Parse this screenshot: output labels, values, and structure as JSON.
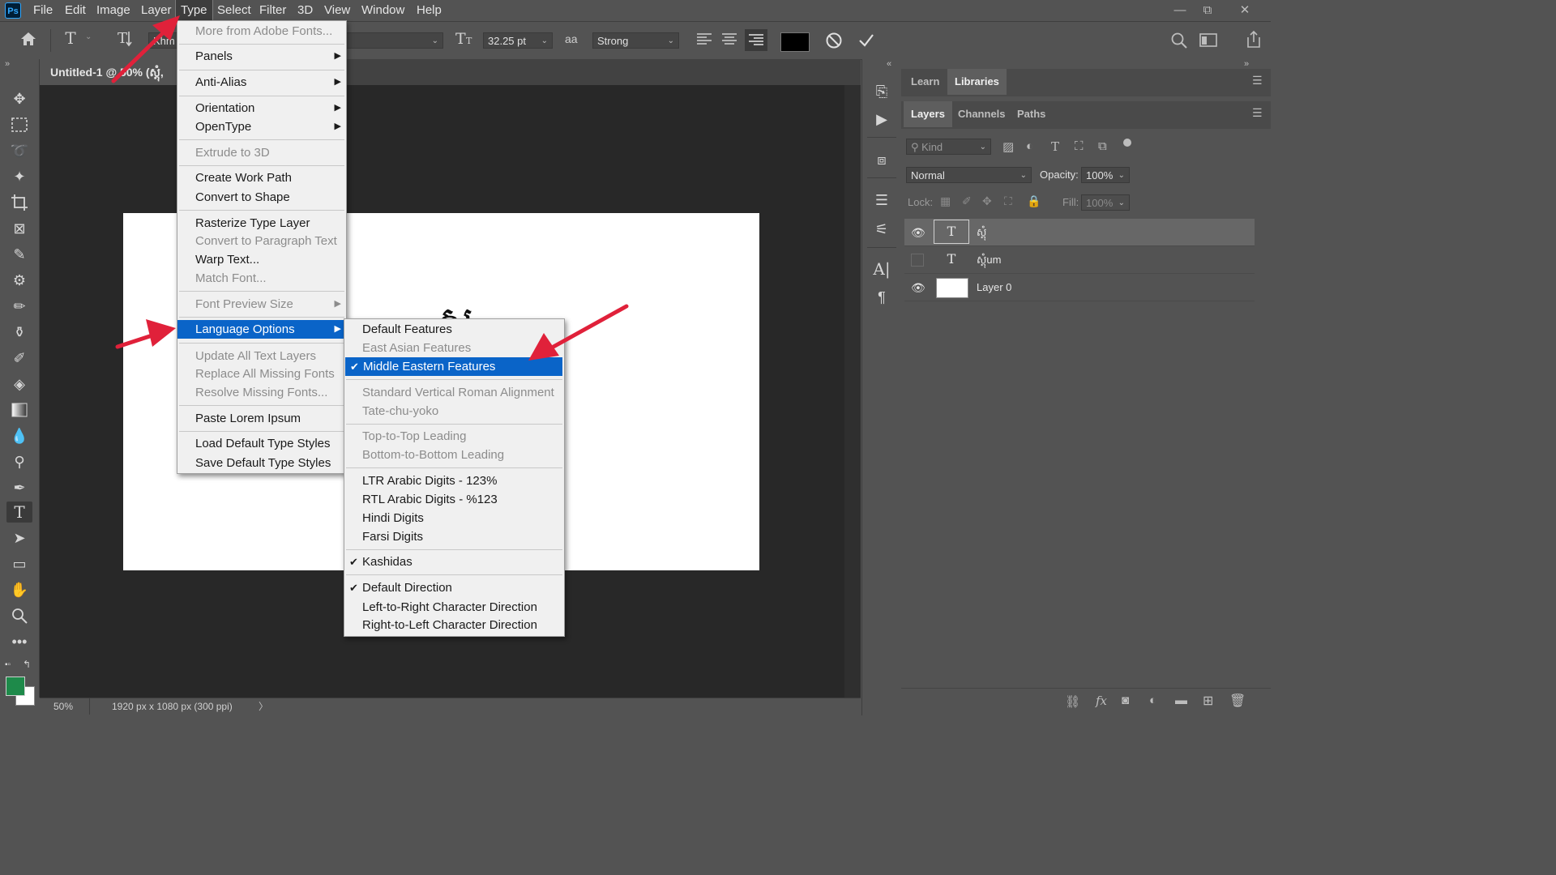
{
  "menubar": {
    "logo": "Ps",
    "items": [
      "File",
      "Edit",
      "Image",
      "Layer",
      "Type",
      "Select",
      "Filter",
      "3D",
      "View",
      "Window",
      "Help"
    ],
    "active": "Type",
    "window_controls": [
      "—",
      "⧉",
      "✕"
    ]
  },
  "options": {
    "font_family": "Khm",
    "font_size": "32.25 pt",
    "anti_alias_icon": "aa",
    "anti_alias": "Strong",
    "color": "#000000"
  },
  "document": {
    "tab_title": "Untitled-1 @ 50% (ស្តុំ,",
    "zoom": "50%",
    "doc_info": "1920 px x 1080 px (300 ppi)",
    "canvas_glyph": "ស"
  },
  "type_menu": {
    "items": [
      {
        "label": "More from Adobe Fonts...",
        "enabled": false
      },
      {
        "label": "Panels",
        "enabled": true,
        "submenu": true
      },
      {
        "label": "Anti-Alias",
        "enabled": true,
        "submenu": true
      },
      {
        "label": "Orientation",
        "enabled": true,
        "submenu": true
      },
      {
        "label": "OpenType",
        "enabled": true,
        "submenu": true
      },
      {
        "label": "Extrude to 3D",
        "enabled": false
      },
      {
        "label": "Create Work Path",
        "enabled": true
      },
      {
        "label": "Convert to Shape",
        "enabled": true
      },
      {
        "label": "Rasterize Type Layer",
        "enabled": true
      },
      {
        "label": "Convert to Paragraph Text",
        "enabled": false
      },
      {
        "label": "Warp Text...",
        "enabled": true
      },
      {
        "label": "Match Font...",
        "enabled": false
      },
      {
        "label": "Font Preview Size",
        "enabled": false,
        "submenu": true
      },
      {
        "label": "Language Options",
        "enabled": true,
        "submenu": true,
        "highlighted": true
      },
      {
        "label": "Update All Text Layers",
        "enabled": false
      },
      {
        "label": "Replace All Missing Fonts",
        "enabled": false
      },
      {
        "label": "Resolve Missing Fonts...",
        "enabled": false
      },
      {
        "label": "Paste Lorem Ipsum",
        "enabled": true
      },
      {
        "label": "Load Default Type Styles",
        "enabled": true
      },
      {
        "label": "Save Default Type Styles",
        "enabled": true
      }
    ]
  },
  "language_submenu": {
    "items": [
      {
        "label": "Default Features",
        "enabled": true,
        "checked": false
      },
      {
        "label": "East Asian Features",
        "enabled": false,
        "checked": false
      },
      {
        "label": "Middle Eastern Features",
        "enabled": true,
        "checked": true,
        "highlighted": true
      },
      {
        "label": "Standard Vertical Roman Alignment",
        "enabled": false,
        "checked": false
      },
      {
        "label": "Tate-chu-yoko",
        "enabled": false,
        "checked": false
      },
      {
        "label": "Top-to-Top Leading",
        "enabled": false,
        "checked": false
      },
      {
        "label": "Bottom-to-Bottom Leading",
        "enabled": false,
        "checked": false
      },
      {
        "label": "LTR Arabic Digits - 123%",
        "enabled": true,
        "checked": false
      },
      {
        "label": "RTL Arabic Digits - %123",
        "enabled": true,
        "checked": false
      },
      {
        "label": "Hindi Digits",
        "enabled": true,
        "checked": false
      },
      {
        "label": "Farsi Digits",
        "enabled": true,
        "checked": false
      },
      {
        "label": "Kashidas",
        "enabled": true,
        "checked": true
      },
      {
        "label": "Default Direction",
        "enabled": true,
        "checked": true
      },
      {
        "label": "Left-to-Right Character Direction",
        "enabled": true,
        "checked": false
      },
      {
        "label": "Right-to-Left Character Direction",
        "enabled": true,
        "checked": false
      }
    ]
  },
  "panels": {
    "top_tabs": [
      "Learn",
      "Libraries"
    ],
    "top_active": "Libraries",
    "layer_tabs": [
      "Layers",
      "Channels",
      "Paths"
    ],
    "layer_active": "Layers",
    "filter_placeholder": "Kind",
    "blend_mode": "Normal",
    "opacity_label": "Opacity:",
    "opacity": "100%",
    "lock_label": "Lock:",
    "fill_label": "Fill:",
    "fill": "100%",
    "layers": [
      {
        "name": "ស្តុំ",
        "type": "text",
        "visible": true,
        "selected": true
      },
      {
        "name": "ស្តុំum",
        "type": "text",
        "visible": false,
        "selected": false
      },
      {
        "name": "Layer 0",
        "type": "pixel",
        "visible": true,
        "selected": false
      }
    ]
  },
  "colors": {
    "foreground": "#1e8a4a",
    "background": "#ffffff",
    "menu_highlight": "#0a64c8",
    "annotation_arrow": "#e0213a"
  }
}
